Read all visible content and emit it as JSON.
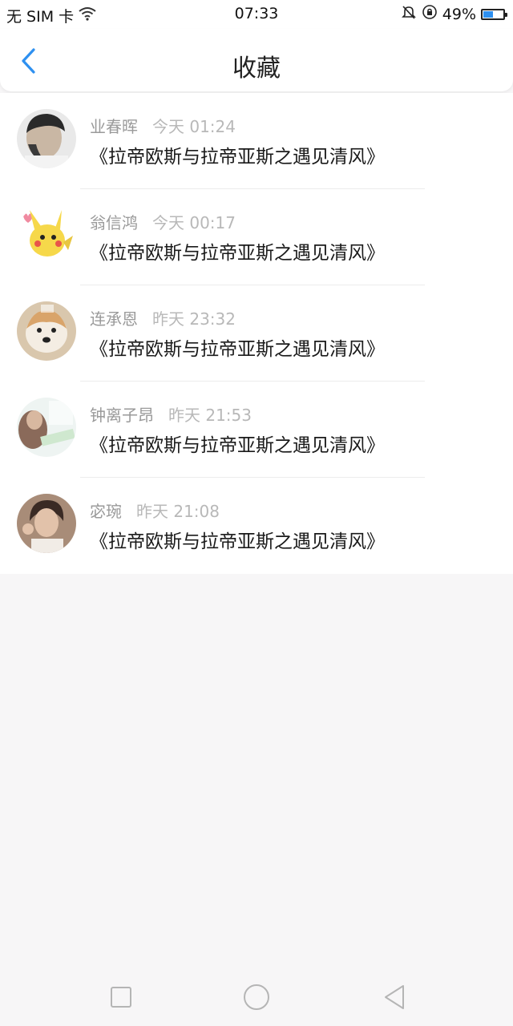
{
  "status_bar": {
    "carrier": "无 SIM 卡",
    "time": "07:33",
    "battery_percent": "49%",
    "battery_level": 0.49,
    "icons": [
      "wifi-icon",
      "mute-bell-icon",
      "rotation-lock-icon",
      "battery-icon"
    ]
  },
  "header": {
    "title": "收藏",
    "back_icon": "chevron-left-icon",
    "accent_color": "#2e90f0"
  },
  "favorites": [
    {
      "name": "业春晖",
      "time": "今天 01:24",
      "title": "《拉帝欧斯与拉帝亚斯之遇见清风》"
    },
    {
      "name": "翁信鸿",
      "time": "今天 00:17",
      "title": "《拉帝欧斯与拉帝亚斯之遇见清风》"
    },
    {
      "name": "连承恩",
      "time": "昨天 23:32",
      "title": "《拉帝欧斯与拉帝亚斯之遇见清风》"
    },
    {
      "name": "钟离子昂",
      "time": "昨天 21:53",
      "title": "《拉帝欧斯与拉帝亚斯之遇见清风》"
    },
    {
      "name": "宓琬",
      "time": "昨天 21:08",
      "title": "《拉帝欧斯与拉帝亚斯之遇见清风》"
    }
  ],
  "nav_bar": {
    "icons": [
      "recents-square-icon",
      "home-circle-icon",
      "back-triangle-icon"
    ]
  }
}
